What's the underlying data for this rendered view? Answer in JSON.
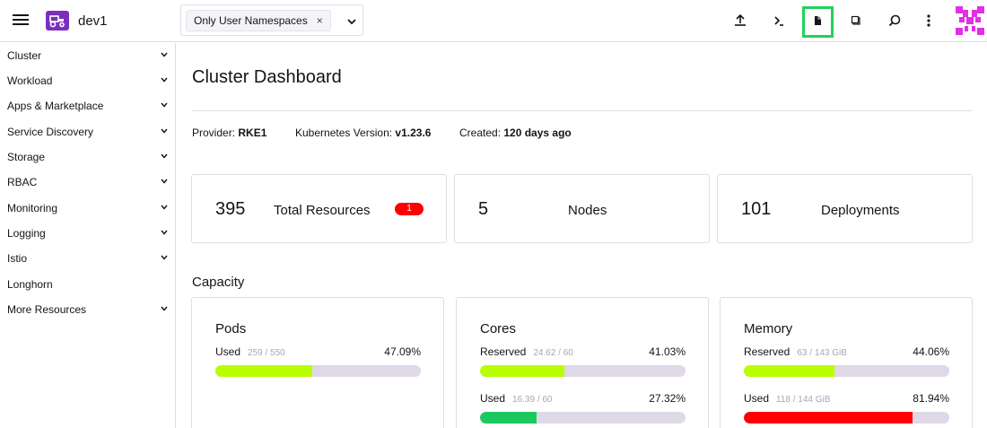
{
  "header": {
    "cluster_name": "dev1",
    "namespace_chip": "Only User Namespaces",
    "namespace_chip_remove": "×",
    "icons": [
      "menu-icon",
      "cluster-tractor-icon",
      "chevron-down-icon",
      "upload-icon",
      "terminal-icon",
      "file-icon",
      "copy-icon",
      "search-icon",
      "more-vert-icon",
      "user-avatar-icon"
    ],
    "accent_color": "#7b2fbf",
    "highlight_color": "#22d15a",
    "avatar_color": "#e22ee5"
  },
  "sidebar": {
    "items": [
      {
        "label": "Cluster",
        "expandable": true
      },
      {
        "label": "Workload",
        "expandable": true
      },
      {
        "label": "Apps & Marketplace",
        "expandable": true
      },
      {
        "label": "Service Discovery",
        "expandable": true
      },
      {
        "label": "Storage",
        "expandable": true
      },
      {
        "label": "RBAC",
        "expandable": true
      },
      {
        "label": "Monitoring",
        "expandable": true
      },
      {
        "label": "Logging",
        "expandable": true
      },
      {
        "label": "Istio",
        "expandable": true
      },
      {
        "label": "Longhorn",
        "expandable": false
      },
      {
        "label": "More Resources",
        "expandable": true
      }
    ]
  },
  "main": {
    "title": "Cluster Dashboard",
    "meta": {
      "provider_label": "Provider:",
      "provider_value": "RKE1",
      "k8s_label": "Kubernetes Version:",
      "k8s_value": "v1.23.6",
      "created_label": "Created:",
      "created_value": "120 days ago"
    },
    "counts": [
      {
        "number": "395",
        "label": "Total Resources",
        "badge": "1"
      },
      {
        "number": "5",
        "label": "Nodes"
      },
      {
        "number": "101",
        "label": "Deployments"
      }
    ],
    "capacity": {
      "title": "Capacity",
      "cards": [
        {
          "name": "Pods",
          "gauges": [
            {
              "label": "Used",
              "detail": "259 / 550",
              "percent_text": "47.09%",
              "percent": 47.09,
              "color": "#b8ff00"
            }
          ]
        },
        {
          "name": "Cores",
          "gauges": [
            {
              "label": "Reserved",
              "detail": "24.62 / 60",
              "percent_text": "41.03%",
              "percent": 41.03,
              "color": "#b8ff00"
            },
            {
              "label": "Used",
              "detail": "16.39 / 60",
              "percent_text": "27.32%",
              "percent": 27.32,
              "color": "#1dc95e"
            }
          ]
        },
        {
          "name": "Memory",
          "gauges": [
            {
              "label": "Reserved",
              "detail": "63 / 143 GiB",
              "percent_text": "44.06%",
              "percent": 44.06,
              "color": "#b8ff00"
            },
            {
              "label": "Used",
              "detail": "118 / 144 GiB",
              "percent_text": "81.94%",
              "percent": 81.94,
              "color": "#ff0000"
            }
          ]
        }
      ]
    }
  }
}
